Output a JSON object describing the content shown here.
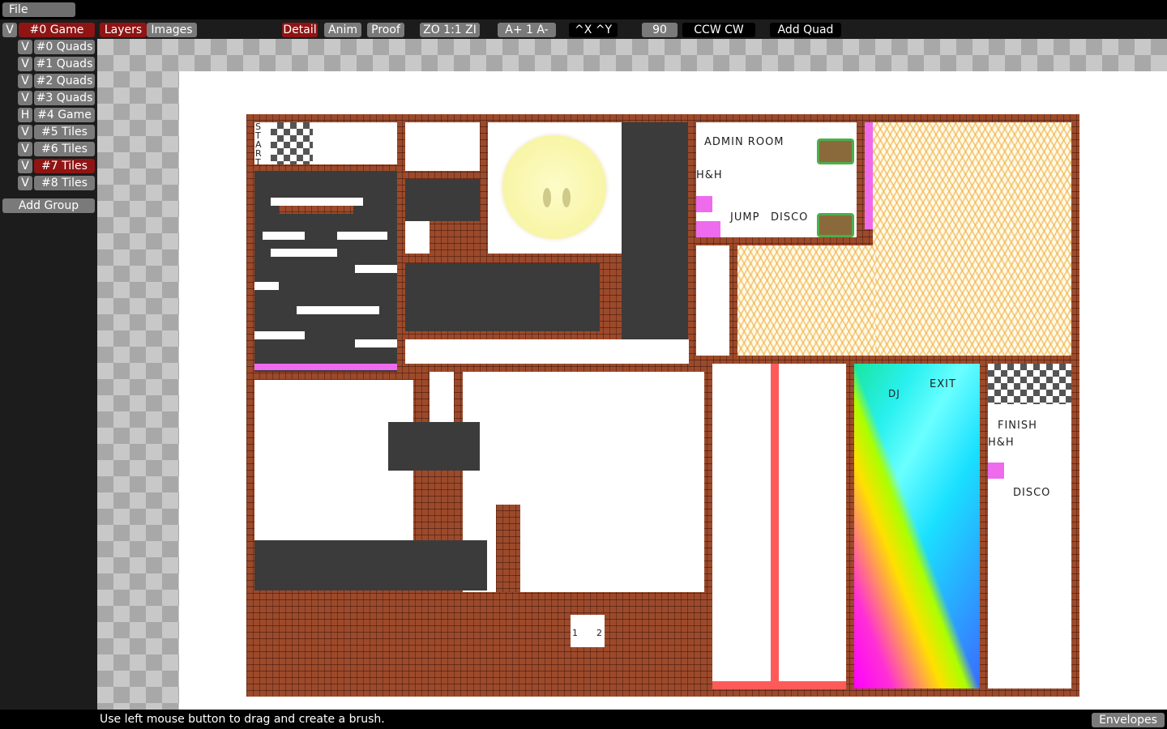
{
  "menu": {
    "file_label": "File"
  },
  "toolbar": {
    "layers": "Layers",
    "images": "Images",
    "detail": "Detail",
    "anim": "Anim",
    "proof": "Proof",
    "zoom": "ZO 1:1  ZI",
    "anim_speed": "A+   1   A-",
    "flip": "^X   ^Y",
    "rotate_amount": "90",
    "rotate": "CCW   CW",
    "add_quad": "Add Quad"
  },
  "groups": [
    {
      "vis": "V",
      "name": "#0 Game",
      "selected": true,
      "indent": false
    },
    {
      "vis": "V",
      "name": "#0 Quads",
      "selected": false,
      "indent": true
    },
    {
      "vis": "V",
      "name": "#1 Quads",
      "selected": false,
      "indent": true
    },
    {
      "vis": "V",
      "name": "#2 Quads",
      "selected": false,
      "indent": true
    },
    {
      "vis": "V",
      "name": "#3 Quads",
      "selected": false,
      "indent": true
    },
    {
      "vis": "H",
      "name": "#4 Game",
      "selected": false,
      "indent": true
    },
    {
      "vis": "V",
      "name": "#5 Tiles",
      "selected": false,
      "indent": true
    },
    {
      "vis": "V",
      "name": "#6 Tiles",
      "selected": false,
      "indent": true
    },
    {
      "vis": "V",
      "name": "#7 Tiles",
      "selected": true,
      "indent": true
    },
    {
      "vis": "V",
      "name": "#8 Tiles",
      "selected": false,
      "indent": true
    }
  ],
  "add_group": "Add Group",
  "map_labels": {
    "start": "S\nT\nA\nR\nT",
    "admin_room": "ADMIN  ROOM",
    "hh1": "H&H",
    "jump": "JUMP",
    "disco1": "DISCO",
    "exit": "EXIT",
    "dj": "DJ",
    "finish": "FINISH",
    "hh2": "H&H",
    "disco2": "DISCO",
    "n1": "1",
    "n2": "2"
  },
  "status": {
    "hint": "Use left mouse button to drag and create a brush.",
    "envelopes": "Envelopes"
  },
  "colors": {
    "selected": "#8f1414",
    "button": "#7a7a7a",
    "brick": "#9c4a2b"
  }
}
